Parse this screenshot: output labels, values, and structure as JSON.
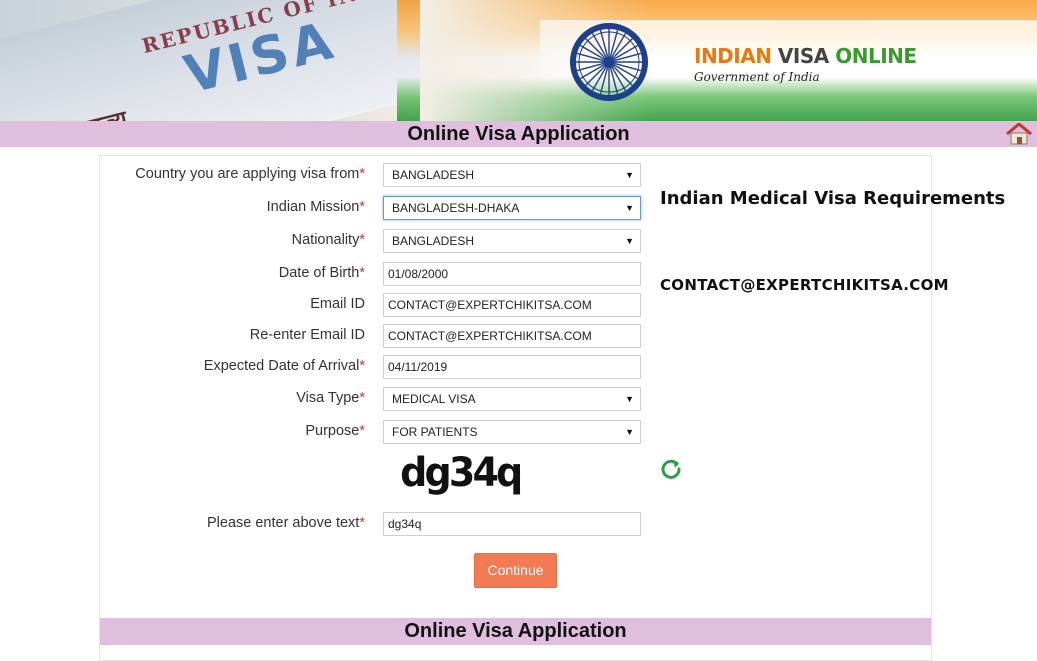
{
  "header": {
    "passport_text": "REPUBLIC OF INDIA",
    "passport_visa": "VISA",
    "passport_hindi": "भारत गणराज्य",
    "logo_word1": "INDIAN",
    "logo_word2": "VISA",
    "logo_word3": "ONLINE",
    "logo_subtitle": "Government of India",
    "colors": {
      "saffron": "#f79a2a",
      "green": "#3a9a2f",
      "navy": "#1e3f8a"
    },
    "emblem_icon": "ashoka-chakra-icon"
  },
  "title_bar": {
    "text": "Online Visa Application",
    "home_icon": "home-icon",
    "background": "#e0bede"
  },
  "form": {
    "fields": [
      {
        "label": "Country you are applying visa from",
        "required": "*",
        "value": "BANGLADESH",
        "type": "select"
      },
      {
        "label": "Indian Mission",
        "required": "*",
        "value": "BANGLADESH-DHAKA",
        "type": "select"
      },
      {
        "label": "Nationality",
        "required": "*",
        "value": "BANGLADESH",
        "type": "select"
      },
      {
        "label": "Date of Birth",
        "required": "*",
        "value": "01/08/2000",
        "type": "input"
      },
      {
        "label": "Email ID",
        "required": "",
        "value": "CONTACT@EXPERTCHIKITSA.COM",
        "type": "input"
      },
      {
        "label": "Re-enter Email ID",
        "required": "",
        "value": "CONTACT@EXPERTCHIKITSA.COM",
        "type": "input"
      },
      {
        "label": "Expected Date of Arrival",
        "required": "*",
        "value": "04/11/2019",
        "type": "input"
      },
      {
        "label": "Visa Type",
        "required": "*",
        "value": "MEDICAL VISA",
        "type": "select"
      },
      {
        "label": "Purpose",
        "required": "*",
        "value": "FOR PATIENTS",
        "type": "select"
      }
    ],
    "captcha": {
      "image_text": "dg34q",
      "refresh_icon": "refresh-icon",
      "label": "Please enter above text",
      "required": "*",
      "value": "dg34q"
    },
    "dropdown_arrow": "▼",
    "continue_label": "Continue",
    "continue_color": "#f47a54"
  },
  "bottom_bar": {
    "text": "Online Visa Application"
  },
  "side": {
    "title": "Indian Medical Visa Requirements",
    "email": "CONTACT@EXPERTCHIKITSA.COM"
  }
}
